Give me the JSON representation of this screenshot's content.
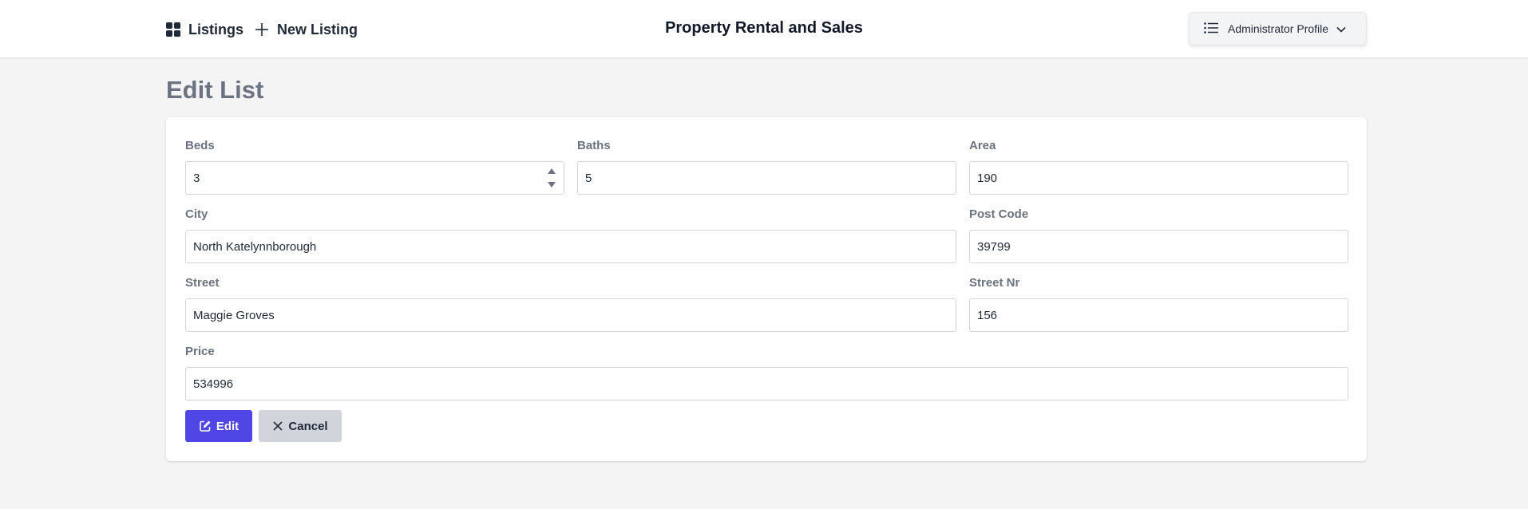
{
  "header": {
    "listings_label": "Listings",
    "new_listing_label": "New Listing",
    "app_title": "Property Rental and Sales",
    "profile_label": "Administrator Profile"
  },
  "page": {
    "heading": "Edit List"
  },
  "form": {
    "beds": {
      "label": "Beds",
      "value": "3"
    },
    "baths": {
      "label": "Baths",
      "value": "5"
    },
    "area": {
      "label": "Area",
      "value": "190"
    },
    "city": {
      "label": "City",
      "value": "North Katelynnborough"
    },
    "post_code": {
      "label": "Post Code",
      "value": "39799"
    },
    "street": {
      "label": "Street",
      "value": "Maggie Groves"
    },
    "street_nr": {
      "label": "Street Nr",
      "value": "156"
    },
    "price": {
      "label": "Price",
      "value": "534996"
    }
  },
  "actions": {
    "edit_label": "Edit",
    "cancel_label": "Cancel"
  },
  "icons": {
    "grid": "grid-icon",
    "plus": "plus-icon",
    "list": "list-icon",
    "chevron": "chevron-down-icon",
    "edit": "edit-icon",
    "close": "close-icon"
  },
  "colors": {
    "primary": "#4f46e5",
    "secondary": "#d1d5db",
    "page_bg": "#f4f4f4"
  }
}
